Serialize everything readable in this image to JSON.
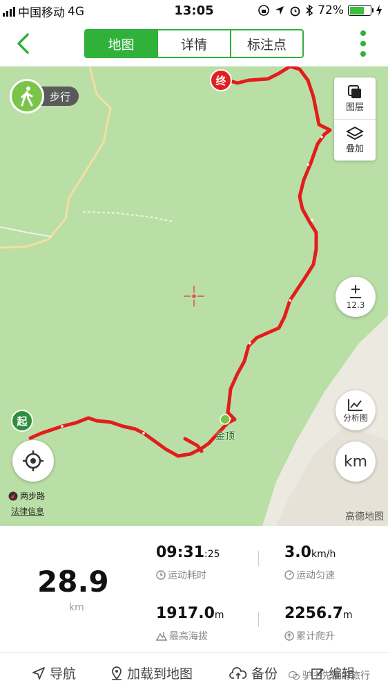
{
  "status_bar": {
    "carrier": "中国移动",
    "network": "4G",
    "time": "13:05",
    "battery": "72%",
    "battery_level": 0.72
  },
  "nav": {
    "tabs": [
      {
        "label": "地图",
        "active": true
      },
      {
        "label": "详情",
        "active": false
      },
      {
        "label": "标注点",
        "active": false
      }
    ]
  },
  "map": {
    "mode_label": "步行",
    "layer_panel": {
      "layers_label": "图层",
      "overlay_label": "叠加"
    },
    "zoom_level": "12.3",
    "analysis_label": "分析图",
    "unit_button": "km",
    "start_marker": "起",
    "end_marker": "终",
    "summit_label": "金顶",
    "road_label": "两步路",
    "legal_link": "法律信息",
    "provider": "高德地图"
  },
  "stats": {
    "distance": "28.9",
    "distance_unit": "km",
    "duration_main": "09:31",
    "duration_sec": ":25",
    "duration_label": "运动耗时",
    "speed": "3.0",
    "speed_unit": "km/h",
    "speed_label": "运动匀速",
    "max_altitude": "1917.0",
    "max_altitude_unit": "m",
    "max_altitude_label": "最高海拔",
    "climb": "2256.7",
    "climb_unit": "m",
    "climb_label": "累计爬升"
  },
  "toolbar": {
    "navigate_label": "导航",
    "load_label": "加载到地图",
    "backup_label": "备份",
    "edit_label": "编辑"
  },
  "watermark": "驴主先生的旅行",
  "colors": {
    "accent": "#2fb13a",
    "map_green": "#b9dfa6",
    "track_red": "#e31c1c"
  }
}
